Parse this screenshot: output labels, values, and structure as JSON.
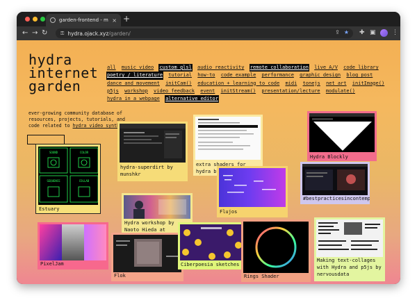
{
  "browser": {
    "tab_title": "garden-frontend - main",
    "tab_close": "×",
    "new_tab": "+",
    "nav_back": "←",
    "nav_forward": "→",
    "nav_reload": "↻",
    "url_host": "hydra.ojack.xyz",
    "url_path": "/garden/",
    "lock": "⚿",
    "share": "⇪",
    "bookmark": "★",
    "extensions": "✚",
    "sidebar": "▣",
    "menu": "⋮"
  },
  "site": {
    "title": "hydra internet garden",
    "description": "ever-growing community database of resources, projects, tutorials, and code related to ",
    "description_link": "hydra video synth"
  },
  "tags": [
    {
      "label": "all",
      "active": false
    },
    {
      "label": "music video",
      "active": false
    },
    {
      "label": "custom glsl",
      "active": true
    },
    {
      "label": "audio reactivity",
      "active": false
    },
    {
      "label": "remote collaboration",
      "active": true
    },
    {
      "label": "live A/V",
      "active": false
    },
    {
      "label": "code library",
      "active": false
    },
    {
      "label": "poetry / literature",
      "active": true
    },
    {
      "label": "tutorial",
      "active": false
    },
    {
      "label": "how-to",
      "active": false
    },
    {
      "label": "code example",
      "active": false
    },
    {
      "label": "performance",
      "active": false
    },
    {
      "label": "graphic design",
      "active": false
    },
    {
      "label": "blog post",
      "active": false
    },
    {
      "label": "dance and movement",
      "active": false
    },
    {
      "label": "initCam()",
      "active": false
    },
    {
      "label": "education + learning to code",
      "active": false
    },
    {
      "label": "midi",
      "active": false
    },
    {
      "label": "tonejs",
      "active": false
    },
    {
      "label": "net art",
      "active": false
    },
    {
      "label": "initImage()",
      "active": false
    },
    {
      "label": "p5js",
      "active": false
    },
    {
      "label": "workshop",
      "active": false
    },
    {
      "label": "video feedback",
      "active": false
    },
    {
      "label": "event",
      "active": false
    },
    {
      "label": "initStream()",
      "active": false
    },
    {
      "label": "presentation/lecture",
      "active": false
    },
    {
      "label": "modulate()",
      "active": false
    },
    {
      "label": "hydra in a webpage",
      "active": false
    },
    {
      "label": "alternative editor",
      "active": true
    }
  ],
  "cards": [
    {
      "title": "Estuary",
      "color": "#f7e07a"
    },
    {
      "title": "hydra-superdirt by munshkr",
      "color": "#f6dc78"
    },
    {
      "title": "extra shaders for hydra by Kandid",
      "color": "#fbe9a0"
    },
    {
      "title": "Hydra Blockly",
      "color": "#f26c8c"
    },
    {
      "title": "Flujos",
      "color": "#f6d36e"
    },
    {
      "title": "#bestpracticesincontemporary",
      "color": "#cfc7ee"
    },
    {
      "title": "Hydra workshop by Naoto Hieda at CityLeaks",
      "color": "#f4e790"
    },
    {
      "title": "PixelJam",
      "color": "#f7688d"
    },
    {
      "title": "Flok",
      "color": "#f4a48a"
    },
    {
      "title": "Ciberpoesia sketches",
      "color": "#dff67a"
    },
    {
      "title": "Rings Shader",
      "color": "#f1a082"
    },
    {
      "title": "Making text-collages with Hydra and p5js by nervousdata",
      "color": "#e3f5a0"
    }
  ],
  "thumbs": {
    "estuary_labels": [
      "SOUND",
      "COLOR",
      "SEQUENCE",
      "COLLAB"
    ]
  }
}
